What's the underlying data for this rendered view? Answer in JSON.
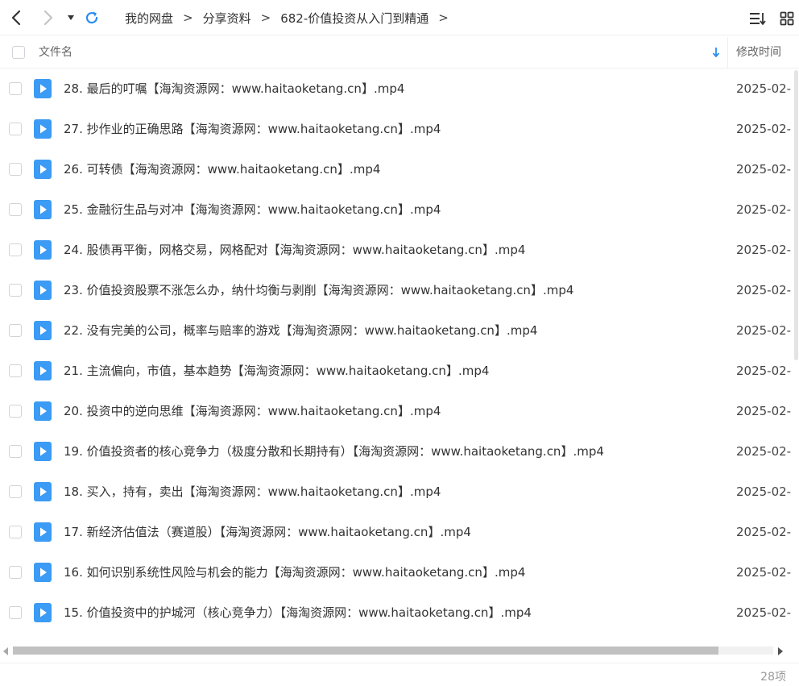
{
  "toolbar": {
    "breadcrumbs": [
      "我的网盘",
      "分享资料",
      "682-价值投资从入门到精通"
    ],
    "separator": ">"
  },
  "header": {
    "name_label": "文件名",
    "time_label": "修改时间"
  },
  "files": [
    {
      "name": "28. 最后的叮嘱【海淘资源网：www.haitaoketang.cn】.mp4",
      "modified": "2025-02-"
    },
    {
      "name": "27. 抄作业的正确思路【海淘资源网：www.haitaoketang.cn】.mp4",
      "modified": "2025-02-"
    },
    {
      "name": "26. 可转债【海淘资源网：www.haitaoketang.cn】.mp4",
      "modified": "2025-02-"
    },
    {
      "name": "25. 金融衍生品与对冲【海淘资源网：www.haitaoketang.cn】.mp4",
      "modified": "2025-02-"
    },
    {
      "name": "24. 股债再平衡，网格交易，网格配对【海淘资源网：www.haitaoketang.cn】.mp4",
      "modified": "2025-02-"
    },
    {
      "name": "23. 价值投资股票不涨怎么办，纳什均衡与剥削【海淘资源网：www.haitaoketang.cn】.mp4",
      "modified": "2025-02-"
    },
    {
      "name": "22. 没有完美的公司，概率与赔率的游戏【海淘资源网：www.haitaoketang.cn】.mp4",
      "modified": "2025-02-"
    },
    {
      "name": "21. 主流偏向，市值，基本趋势【海淘资源网：www.haitaoketang.cn】.mp4",
      "modified": "2025-02-"
    },
    {
      "name": "20. 投资中的逆向思维【海淘资源网：www.haitaoketang.cn】.mp4",
      "modified": "2025-02-"
    },
    {
      "name": "19. 价值投资者的核心竞争力（极度分散和长期持有）【海淘资源网：www.haitaoketang.cn】.mp4",
      "modified": "2025-02-"
    },
    {
      "name": "18. 买入，持有，卖出【海淘资源网：www.haitaoketang.cn】.mp4",
      "modified": "2025-02-"
    },
    {
      "name": "17. 新经济估值法（赛道股）【海淘资源网：www.haitaoketang.cn】.mp4",
      "modified": "2025-02-"
    },
    {
      "name": "16. 如何识别系统性风险与机会的能力【海淘资源网：www.haitaoketang.cn】.mp4",
      "modified": "2025-02-"
    },
    {
      "name": "15. 价值投资中的护城河（核心竞争力）【海淘资源网：www.haitaoketang.cn】.mp4",
      "modified": "2025-02-"
    }
  ],
  "status": {
    "item_count": "28项"
  },
  "colors": {
    "accent": "#2a8cf0",
    "file_icon": "#3b9bf5"
  }
}
